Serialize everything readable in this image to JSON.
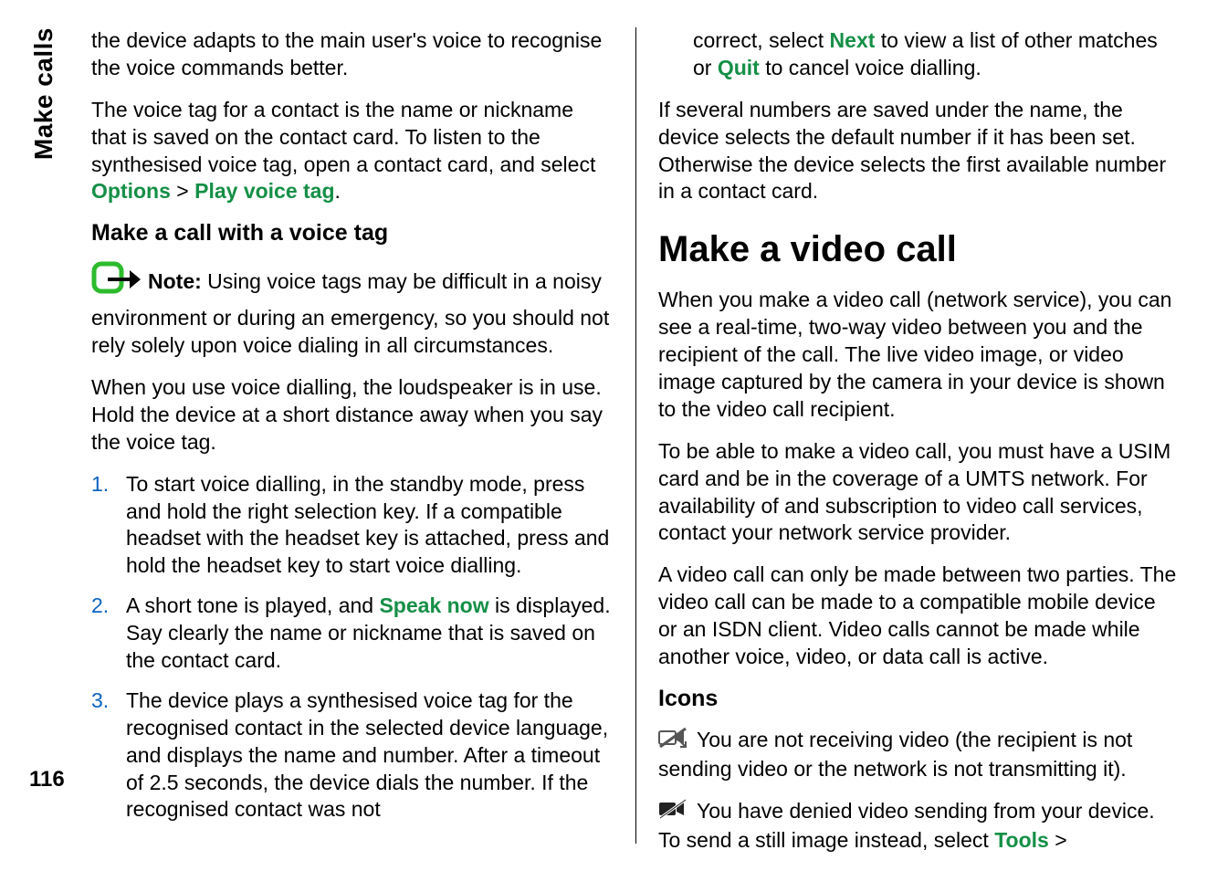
{
  "sidebar_tab": "Make calls",
  "page_number": "116",
  "left": {
    "p1_a": "the device adapts to the main user's voice to recognise the voice commands better.",
    "p2_a": "The voice tag for a contact is the name or nickname that is saved on the contact card. To listen to the synthesised voice tag, open a contact card, and select ",
    "p2_opt": "Options",
    "p2_gt": " > ",
    "p2_play": "Play voice tag",
    "p2_end": ".",
    "subheading": "Make a call with a voice tag",
    "note_label": "Note:  ",
    "note_text": "Using voice tags may be difficult in a noisy environment or during an emergency, so you should not rely solely upon voice dialing in all circumstances.",
    "p3": "When you use voice dialling, the loudspeaker is in use. Hold the device at a short distance away when you say the voice tag.",
    "steps": {
      "s1": "To start voice dialling, in the standby mode, press and hold the right selection key. If a compatible headset with the headset key is attached, press and hold the headset key to start voice dialling.",
      "s2_a": "A short tone is played, and ",
      "s2_speak": "Speak now",
      "s2_b": " is displayed. Say clearly the name or nickname that is saved on the contact card.",
      "s3": "The device plays a synthesised voice tag for the recognised contact in the selected device language, and displays the name and number. After a timeout of 2.5 seconds, the device dials the number. If the recognised contact was not"
    }
  },
  "right": {
    "p_cont_a": "correct, select ",
    "p_cont_next": "Next",
    "p_cont_b": " to view a list of other matches or ",
    "p_cont_quit": "Quit",
    "p_cont_c": " to cancel voice dialling.",
    "p2": "If several numbers are saved under the name, the device selects the default number if it has been set. Otherwise the device selects the first available number in a contact card.",
    "section": "Make a video call",
    "p3": "When you make a video call (network service), you can see a real-time, two-way video between you and the recipient of the call. The live video image, or video image captured by the camera in your device is shown to the video call recipient.",
    "p4": "To be able to make a video call, you must have a USIM card and be in the coverage of a UMTS network. For availability of and subscription to video call services, contact your network service provider.",
    "p5": "A video call can only be made between two parties. The video call can be made to a compatible mobile device or an ISDN client. Video calls cannot be made while another voice, video, or data call is active.",
    "icons_heading": "Icons",
    "icon1_text": " You are not receiving video (the recipient is not sending video or the network is not transmitting it).",
    "icon2_a": " You have denied video sending from your device. To send a still image instead, select ",
    "icon2_tools": "Tools",
    "icon2_gt": " >"
  }
}
